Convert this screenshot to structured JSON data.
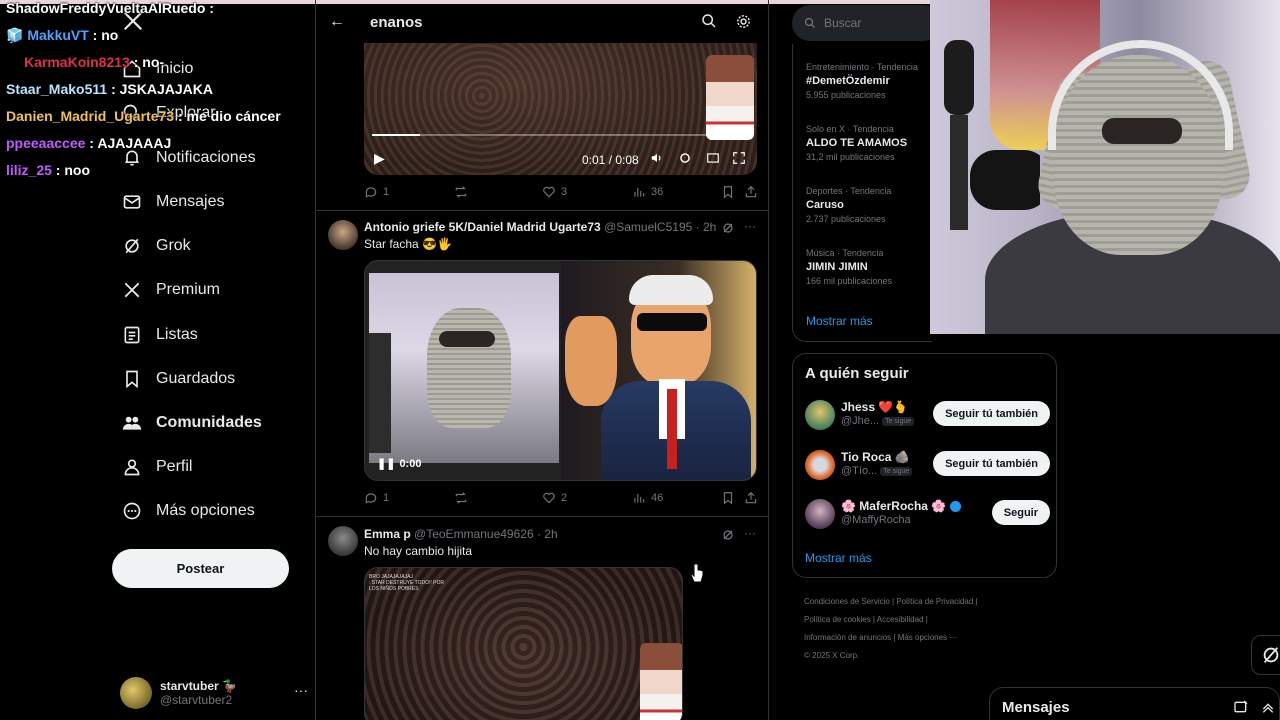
{
  "nav": {
    "items": [
      {
        "label": "Inicio",
        "icon": "home-icon"
      },
      {
        "label": "Explorar",
        "icon": "search-icon"
      },
      {
        "label": "Notificaciones",
        "icon": "bell-icon"
      },
      {
        "label": "Mensajes",
        "icon": "mail-icon"
      },
      {
        "label": "Grok",
        "icon": "grok-icon"
      },
      {
        "label": "Premium",
        "icon": "x-icon"
      },
      {
        "label": "Listas",
        "icon": "list-icon"
      },
      {
        "label": "Guardados",
        "icon": "bookmark-icon"
      },
      {
        "label": "Comunidades",
        "icon": "communities-icon"
      },
      {
        "label": "Perfil",
        "icon": "person-icon"
      },
      {
        "label": "Más opciones",
        "icon": "more-circle-icon"
      }
    ],
    "post_button": "Postear",
    "account": {
      "name": "starvtuber �without",
      "name_display": "starvtuber 🦆",
      "handle": "@starvtuber2"
    }
  },
  "chat": [
    {
      "user": "ShadowFreddyVueltaAlRuedo",
      "sep": " : ",
      "msg": "",
      "color": "#ffffff"
    },
    {
      "user": "MakkuVT",
      "sep": " : ",
      "msg": "no",
      "color": "#4aa3ff"
    },
    {
      "user": "KarmaKoin8213",
      "sep": " : ",
      "msg": "no-",
      "color": "#e0304a"
    },
    {
      "user": "Staar_Mako511",
      "sep": " : ",
      "msg": "JSKAJAJAKA",
      "color": "#b9e4ff"
    },
    {
      "user": "Danien_Madrid_Ugarte73",
      "sep": " : ",
      "msg": "me dio cáncer",
      "color": "#f2c14e"
    },
    {
      "user": "ppeeaaccee",
      "sep": " : ",
      "msg": "AJAJAAAJ",
      "color": "#c05cff"
    },
    {
      "user": "liliz_25",
      "sep": " : ",
      "msg": "noo",
      "color": "#c05cff"
    }
  ],
  "feed": {
    "title": "enanos",
    "post1": {
      "time": "0:01 / 0:08",
      "progress": 0.13,
      "replies": "1",
      "reposts": "",
      "likes": "3",
      "views": "36"
    },
    "post2": {
      "name": "Antonio griefe 5K/Daniel Madrid Ugarte73",
      "handle": "@SamuelC5195",
      "time": "· 2h",
      "text": "Star facha 😎🖐",
      "video_time": "0:00",
      "replies": "1",
      "reposts": "",
      "likes": "2",
      "views": "46"
    },
    "post3": {
      "name": "Emma p",
      "handle": "@TeoEmmanue49626",
      "time": "· 2h",
      "text": "No hay cambio hijita",
      "caption": "BRO JAJAJAJAJAJ\n: STAR DESTRUYE TODO!! POR\nLOS NIÑOS POBRES"
    }
  },
  "search": {
    "placeholder": "Buscar"
  },
  "trends": [
    {
      "category": "Entretenimiento · Tendencia",
      "name": "#DemetÖzdemir",
      "count": "5.955 publicaciones"
    },
    {
      "category": "Solo en X · Tendencia",
      "name": "ALDO TE AMAMOS",
      "count": "31,2 mil publicaciones"
    },
    {
      "category": "Deportes · Tendencia",
      "name": "Caruso",
      "count": "2.737 publicaciones"
    },
    {
      "category": "Música · Tendencia",
      "name": "JIMIN JIMIN",
      "count": "166 mil publicaciones"
    }
  ],
  "trends_more": "Mostrar más",
  "who_to_follow": {
    "title": "A quién seguir",
    "users": [
      {
        "name": "Jhess ❤️🫰",
        "handle": "@Jhe...",
        "tag": "Te sigue",
        "button": "Seguir tú también"
      },
      {
        "name": "Tio Roca 🪨",
        "handle": "@Tío...",
        "tag": "Te sigue",
        "button": "Seguir tú también"
      },
      {
        "name": "🌸 MaferRocha 🌸",
        "handle": "@MaffyRocha",
        "tag": "",
        "button": "Seguir"
      }
    ],
    "more": "Mostrar más"
  },
  "footer": {
    "line1": "Condiciones de Servicio  |  Política de Privacidad  |",
    "line2": "Política de cookies  |  Accesibilidad  |",
    "line3": "Información de anuncios  |  Más opciones ···",
    "line4": "© 2025 X Corp."
  },
  "messages_bar": {
    "title": "Mensajes"
  },
  "colors": {
    "accent": "#1d9bf0",
    "bg": "#000000",
    "border": "#2f3336",
    "muted": "#71767b"
  }
}
